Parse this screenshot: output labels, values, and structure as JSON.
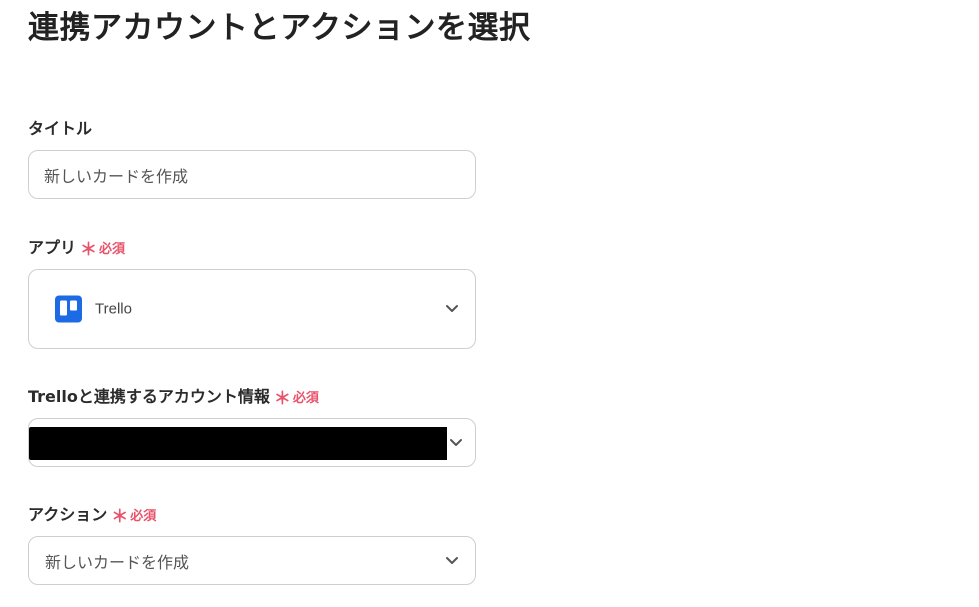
{
  "page": {
    "title": "連携アカウントとアクションを選択"
  },
  "fields": {
    "title": {
      "label": "タイトル",
      "value": "新しいカードを作成"
    },
    "app": {
      "label": "アプリ",
      "required_mark": "＊",
      "required_text": "必須",
      "selected_app": "Trello",
      "icon": "trello-logo-icon"
    },
    "account": {
      "label": "Trelloと連携するアカウント情報",
      "required_mark": "＊",
      "required_text": "必須",
      "value_redacted": true
    },
    "action": {
      "label": "アクション",
      "required_mark": "＊",
      "required_text": "必須",
      "selected_value": "新しいカードを作成"
    }
  },
  "colors": {
    "required": "#e8536b",
    "trello_blue": "#1d6ae5",
    "border": "#cfcfcf",
    "title_text": "#222222"
  }
}
